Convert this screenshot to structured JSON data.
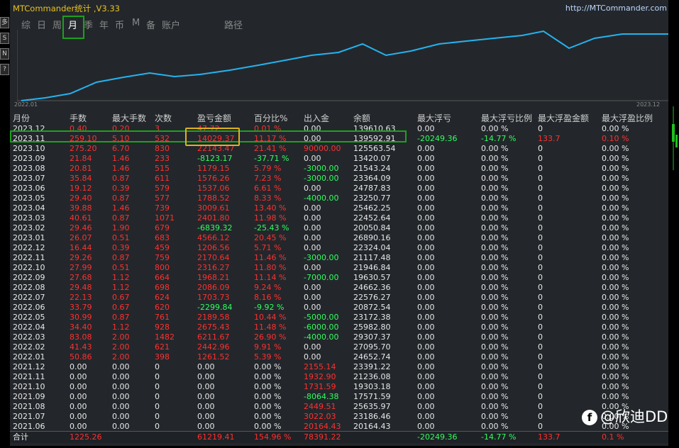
{
  "app": {
    "title": "MTCommander统计 ,V3.33",
    "url": "http://MTCommander.com"
  },
  "tabs": [
    {
      "label": "综"
    },
    {
      "label": "日"
    },
    {
      "label": "周"
    },
    {
      "label": "月"
    },
    {
      "label": "季"
    },
    {
      "label": "年"
    },
    {
      "label": "币"
    },
    {
      "label": "M"
    },
    {
      "label": "备"
    },
    {
      "label": "账户"
    },
    {
      "label": "路径"
    }
  ],
  "active_tab": "月",
  "side_buttons": [
    "多",
    "S",
    "N",
    "?"
  ],
  "chart": {
    "start_label": "2022.01",
    "end_label": "2023.12",
    "line_color": "#25b2f0"
  },
  "columns": [
    "月份",
    "手数",
    "最大手数",
    "次数",
    "盈亏金额",
    "百分比%",
    "出入金",
    "余额",
    "最大浮亏",
    "最大浮亏比例",
    "最大浮盈金额",
    "最大浮盈比例"
  ],
  "rows": [
    [
      "2023.12",
      "0.40",
      "0.20",
      "3",
      "47.72",
      "0.01 %",
      "0.00",
      "139610.63",
      "0.00",
      "0.00 %",
      "0",
      "0.00 %"
    ],
    [
      "2023.11",
      "259.10",
      "5.10",
      "532",
      "14029.37",
      "11.17 %",
      "0.00",
      "139592.91",
      "-20249.36",
      "-14.77 %",
      "133.7",
      "0.10 %"
    ],
    [
      "2023.10",
      "275.20",
      "6.70",
      "830",
      "22143.47",
      "21.41 %",
      "90000.00",
      "125563.54",
      "0.00",
      "0.00 %",
      "0",
      "0.00 %"
    ],
    [
      "2023.09",
      "21.84",
      "1.46",
      "233",
      "-8123.17",
      "-37.71 %",
      "0.00",
      "13420.07",
      "0.00",
      "0.00 %",
      "0",
      "0.00 %"
    ],
    [
      "2023.08",
      "20.81",
      "1.46",
      "515",
      "1179.15",
      "5.79 %",
      "-3000.00",
      "21543.24",
      "0.00",
      "0.00 %",
      "0",
      "0.00 %"
    ],
    [
      "2023.07",
      "35.84",
      "0.87",
      "611",
      "1576.26",
      "7.23 %",
      "-3000.00",
      "23364.09",
      "0.00",
      "0.00 %",
      "0",
      "0.00 %"
    ],
    [
      "2023.06",
      "19.12",
      "0.39",
      "579",
      "1537.06",
      "6.61 %",
      "0.00",
      "24787.83",
      "0.00",
      "0.00 %",
      "0",
      "0.00 %"
    ],
    [
      "2023.05",
      "29.40",
      "0.87",
      "577",
      "1788.52",
      "8.33 %",
      "-4000.00",
      "23250.77",
      "0.00",
      "0.00 %",
      "0",
      "0.00 %"
    ],
    [
      "2023.04",
      "39.88",
      "1.46",
      "739",
      "3009.61",
      "13.40 %",
      "0.00",
      "25462.25",
      "0.00",
      "0.00 %",
      "0",
      "0.00 %"
    ],
    [
      "2023.03",
      "40.61",
      "0.87",
      "1071",
      "2401.80",
      "11.98 %",
      "0.00",
      "22452.64",
      "0.00",
      "0.00 %",
      "0",
      "0.00 %"
    ],
    [
      "2023.02",
      "29.46",
      "1.90",
      "679",
      "-6839.32",
      "-25.43 %",
      "0.00",
      "20050.84",
      "0.00",
      "0.00 %",
      "0",
      "0.00 %"
    ],
    [
      "2023.01",
      "26.07",
      "0.51",
      "683",
      "4566.12",
      "20.45 %",
      "0.00",
      "26890.16",
      "0.00",
      "0.00 %",
      "0",
      "0.00 %"
    ],
    [
      "2022.12",
      "16.44",
      "0.39",
      "459",
      "1206.56",
      "5.71 %",
      "0.00",
      "22324.04",
      "0.00",
      "0.00 %",
      "0",
      "0.00 %"
    ],
    [
      "2022.11",
      "29.26",
      "0.87",
      "759",
      "2170.64",
      "11.46 %",
      "-3000.00",
      "21117.48",
      "0.00",
      "0.00 %",
      "0",
      "0.00 %"
    ],
    [
      "2022.10",
      "27.99",
      "0.51",
      "800",
      "2316.27",
      "11.80 %",
      "0.00",
      "21946.84",
      "0.00",
      "0.00 %",
      "0",
      "0.00 %"
    ],
    [
      "2022.09",
      "27.68",
      "1.12",
      "664",
      "1968.21",
      "11.14 %",
      "-7000.00",
      "19630.57",
      "0.00",
      "0.00 %",
      "0",
      "0.00 %"
    ],
    [
      "2022.08",
      "29.48",
      "1.12",
      "698",
      "2086.09",
      "9.24 %",
      "0.00",
      "24662.36",
      "0.00",
      "0.00 %",
      "0",
      "0.00 %"
    ],
    [
      "2022.07",
      "22.13",
      "0.67",
      "624",
      "1703.73",
      "8.16 %",
      "0.00",
      "22576.27",
      "0.00",
      "0.00 %",
      "0",
      "0.00 %"
    ],
    [
      "2022.06",
      "33.79",
      "0.67",
      "620",
      "-2299.84",
      "-9.92 %",
      "0.00",
      "20872.54",
      "0.00",
      "0.00 %",
      "0",
      "0.00 %"
    ],
    [
      "2022.05",
      "30.99",
      "0.87",
      "761",
      "2189.58",
      "10.44 %",
      "-5000.00",
      "23172.38",
      "0.00",
      "0.00 %",
      "0",
      "0.00 %"
    ],
    [
      "2022.04",
      "34.40",
      "1.12",
      "928",
      "2675.43",
      "11.48 %",
      "-6000.00",
      "25982.80",
      "0.00",
      "0.00 %",
      "0",
      "0.00 %"
    ],
    [
      "2022.03",
      "83.08",
      "2.00",
      "1482",
      "6211.67",
      "26.90 %",
      "-4000.00",
      "29307.37",
      "0.00",
      "0.00 %",
      "0",
      "0.00 %"
    ],
    [
      "2022.02",
      "41.43",
      "2.00",
      "621",
      "2442.96",
      "9.91 %",
      "0.00",
      "27095.70",
      "0.00",
      "0.00 %",
      "0",
      "0.00 %"
    ],
    [
      "2022.01",
      "50.86",
      "2.00",
      "398",
      "1261.52",
      "5.39 %",
      "0.00",
      "24652.74",
      "0.00",
      "0.00 %",
      "0",
      "0.00 %"
    ],
    [
      "2021.12",
      "0.00",
      "0.00",
      "0",
      "0.00",
      "0.00 %",
      "2155.14",
      "23391.22",
      "0.00",
      "0.00 %",
      "0",
      "0.00 %"
    ],
    [
      "2021.11",
      "0.00",
      "0.00",
      "0",
      "0.00",
      "0.00 %",
      "1932.90",
      "21236.08",
      "0.00",
      "0.00 %",
      "0",
      "0.00 %"
    ],
    [
      "2021.10",
      "0.00",
      "0.00",
      "0",
      "0.00",
      "0.00 %",
      "1731.59",
      "19303.18",
      "0.00",
      "0.00 %",
      "0",
      "0.00 %"
    ],
    [
      "2021.09",
      "0.00",
      "0.00",
      "0",
      "0.00",
      "0.00 %",
      "-8064.38",
      "17571.59",
      "0.00",
      "0.00 %",
      "0",
      "0.00 %"
    ],
    [
      "2021.08",
      "0.00",
      "0.00",
      "0",
      "0.00",
      "0.00 %",
      "2449.51",
      "25635.97",
      "0.00",
      "0.00 %",
      "0",
      "0.00 %"
    ],
    [
      "2021.07",
      "0.00",
      "0.00",
      "0",
      "0.00",
      "0.00 %",
      "3022.03",
      "23186.46",
      "0.00",
      "0.00 %",
      "0",
      "0.00 %"
    ],
    [
      "2021.06",
      "0.00",
      "0.00",
      "0",
      "0.00",
      "0.00 %",
      "20164.43",
      "20164.43",
      "0.00",
      "0.00 %",
      "0",
      "0.00 %"
    ]
  ],
  "total": [
    "合计",
    "1225.26",
    "",
    "",
    "61219.41",
    "154.96 %",
    "78391.22",
    "",
    "-20249.36",
    "-14.77 %",
    "133.7",
    "0.1 %"
  ],
  "watermark": "@欣迪DD",
  "watermark_icon": "f"
}
